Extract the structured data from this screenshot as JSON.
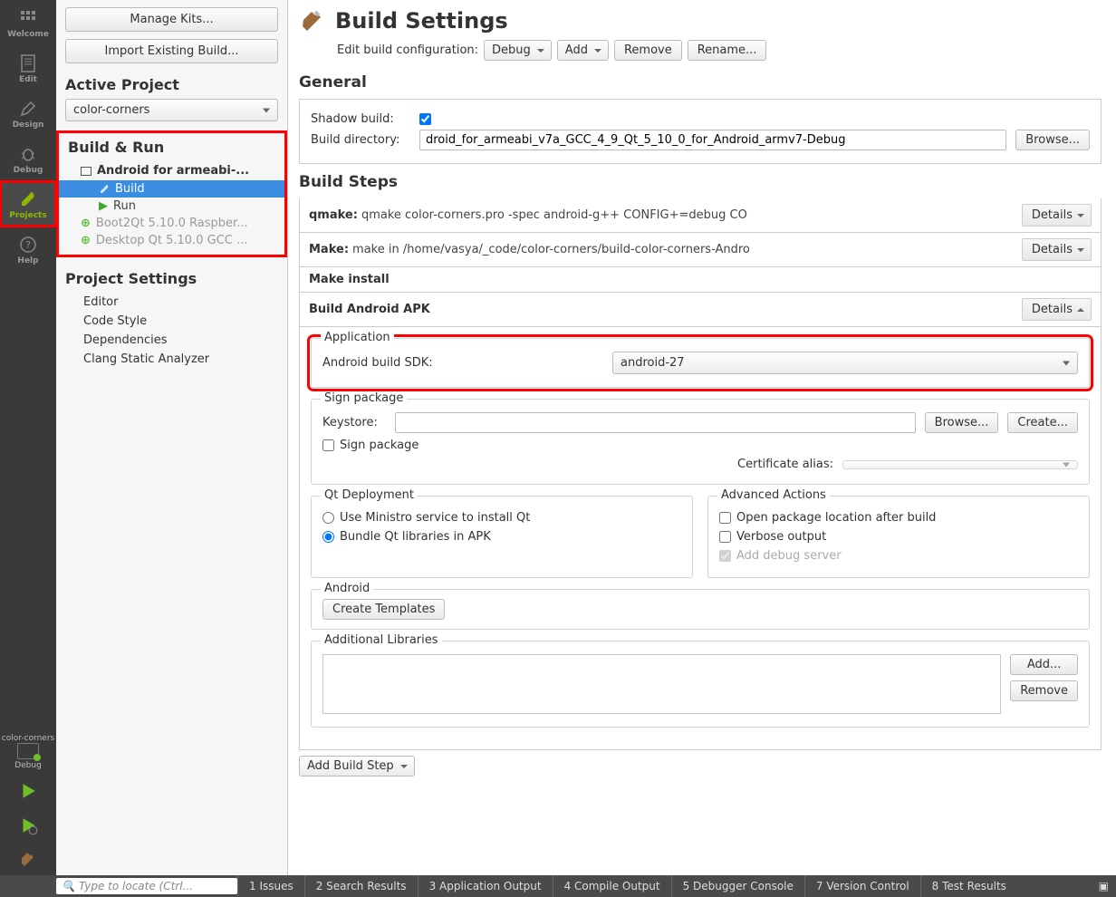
{
  "modebar": {
    "items": [
      {
        "label": "Welcome"
      },
      {
        "label": "Edit"
      },
      {
        "label": "Design"
      },
      {
        "label": "Debug"
      },
      {
        "label": "Projects"
      },
      {
        "label": "Help"
      }
    ],
    "target": {
      "project": "color-corners",
      "mode": "Debug"
    }
  },
  "projpanel": {
    "manage_kits": "Manage Kits...",
    "import_build": "Import Existing Build...",
    "active_project_heading": "Active Project",
    "active_project": "color-corners",
    "build_run_heading": "Build & Run",
    "kit_active": "Android for armeabi-...",
    "build_label": "Build",
    "run_label": "Run",
    "kit_disabled1": "Boot2Qt 5.10.0 Raspber...",
    "kit_disabled2": "Desktop Qt 5.10.0 GCC ...",
    "project_settings_heading": "Project Settings",
    "settings": [
      "Editor",
      "Code Style",
      "Dependencies",
      "Clang Static Analyzer"
    ]
  },
  "page": {
    "title": "Build Settings",
    "edit_config_label": "Edit build configuration:",
    "config": "Debug",
    "add": "Add",
    "remove": "Remove",
    "rename": "Rename..."
  },
  "general": {
    "heading": "General",
    "shadow_label": "Shadow build:",
    "shadow_checked": true,
    "builddir_label": "Build directory:",
    "builddir": "droid_for_armeabi_v7a_GCC_4_9_Qt_5_10_0_for_Android_armv7-Debug",
    "browse": "Browse..."
  },
  "steps": {
    "heading": "Build Steps",
    "qmake_label": "qmake:",
    "qmake_text": "qmake color-corners.pro -spec android-g++ CONFIG+=debug CO",
    "make_label": "Make:",
    "make_text": "make in /home/vasya/_code/color-corners/build-color-corners-Andro",
    "makeinstall_label": "Make install",
    "apk_label": "Build Android APK",
    "details": "Details"
  },
  "apk": {
    "app": {
      "title": "Application",
      "sdk_label": "Android build SDK:",
      "sdk_value": "android-27"
    },
    "sign": {
      "title": "Sign package",
      "keystore_label": "Keystore:",
      "browse": "Browse...",
      "create": "Create...",
      "sign_label": "Sign package",
      "cert_label": "Certificate alias:"
    },
    "deploy": {
      "title": "Qt Deployment",
      "opt1": "Use Ministro service to install Qt",
      "opt2": "Bundle Qt libraries in APK"
    },
    "adv": {
      "title": "Advanced Actions",
      "c1": "Open package location after build",
      "c2": "Verbose output",
      "c3": "Add debug server"
    },
    "android": {
      "title": "Android",
      "create_templates": "Create Templates"
    },
    "libs": {
      "title": "Additional Libraries",
      "add": "Add...",
      "remove": "Remove"
    },
    "add_step": "Add Build Step"
  },
  "bottombar": {
    "locate_placeholder": "Type to locate (Ctrl...",
    "tabs": [
      "1 Issues",
      "2 Search Results",
      "3 Application Output",
      "4 Compile Output",
      "5 Debugger Console",
      "7 Version Control",
      "8 Test Results"
    ]
  }
}
